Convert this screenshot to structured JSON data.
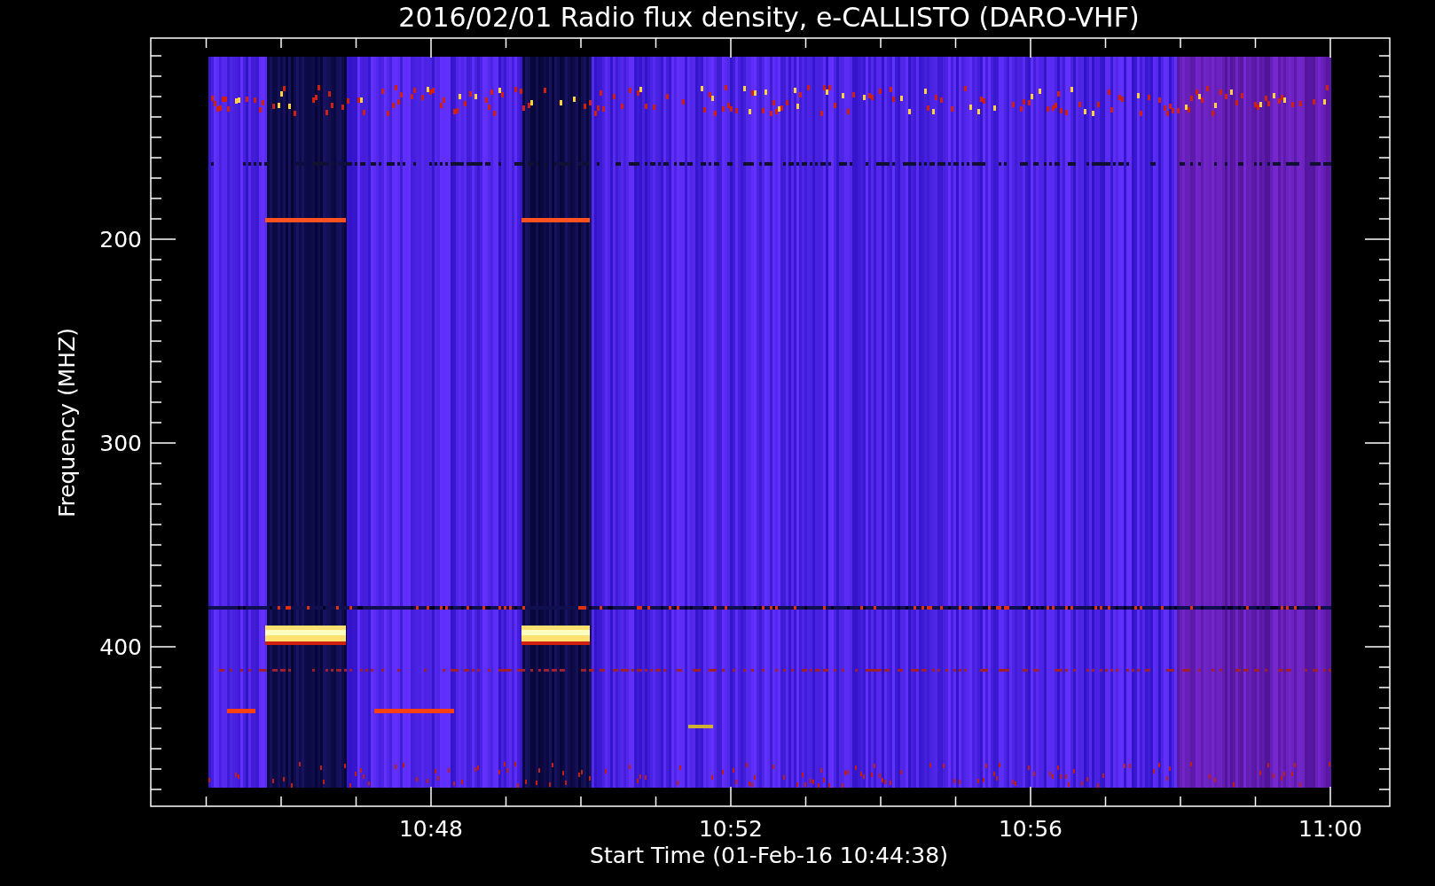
{
  "title": "2016/02/01  Radio flux density, e-CALLISTO (DARO-VHF)",
  "y_axis": {
    "label": "Frequency (MHZ)",
    "ticks": [
      "200",
      "300",
      "400"
    ]
  },
  "x_axis": {
    "label": "Start Time (01-Feb-16 10:44:38)",
    "ticks": [
      "10:48",
      "10:52",
      "10:56",
      "11:00"
    ]
  }
}
